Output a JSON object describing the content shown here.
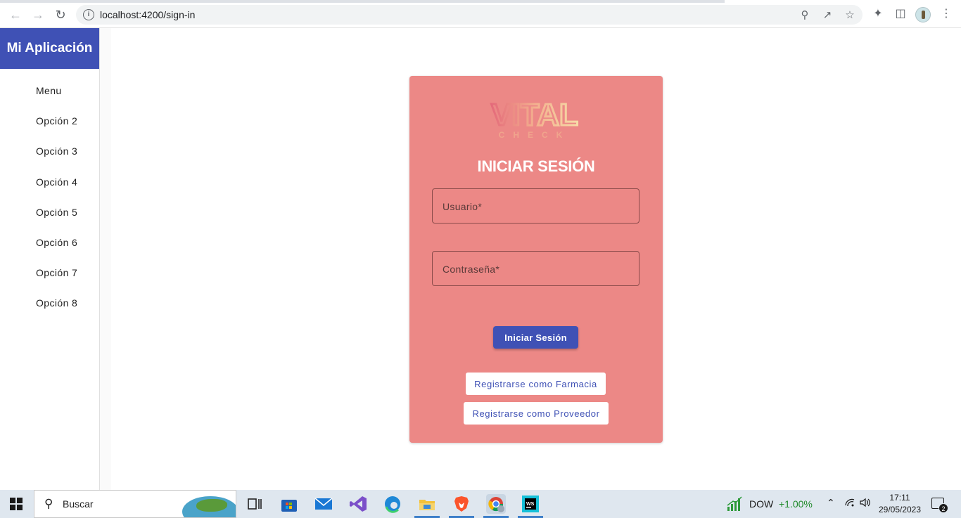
{
  "browser": {
    "url": "localhost:4200/sign-in",
    "back_icon": "arrow-left-icon",
    "forward_icon": "arrow-right-icon",
    "reload_icon": "reload-icon"
  },
  "sidebar": {
    "brand": "Mi Aplicación",
    "items": [
      {
        "label": "Menu"
      },
      {
        "label": "Opción 2"
      },
      {
        "label": "Opción 3"
      },
      {
        "label": "Opción 4"
      },
      {
        "label": "Opción 5"
      },
      {
        "label": "Opción 6"
      },
      {
        "label": "Opción 7"
      },
      {
        "label": "Opción 8"
      }
    ]
  },
  "login": {
    "logo_text": "VITAL",
    "logo_subtext": "CHECK",
    "title": "INICIAR SESIÓN",
    "username_label": "Usuario*",
    "password_label": "Contraseña*",
    "submit_label": "Iniciar Sesión",
    "register_pharmacy_label": "Registrarse como Farmacia",
    "register_supplier_label": "Registrarse como Proveedor",
    "card_color": "#ec8886",
    "accent_color": "#3f51b5"
  },
  "taskbar": {
    "search_placeholder": "Buscar",
    "ticker_name": "DOW",
    "ticker_change": "+1.00%",
    "time": "17:11",
    "date": "29/05/2023",
    "notification_count": "2"
  }
}
